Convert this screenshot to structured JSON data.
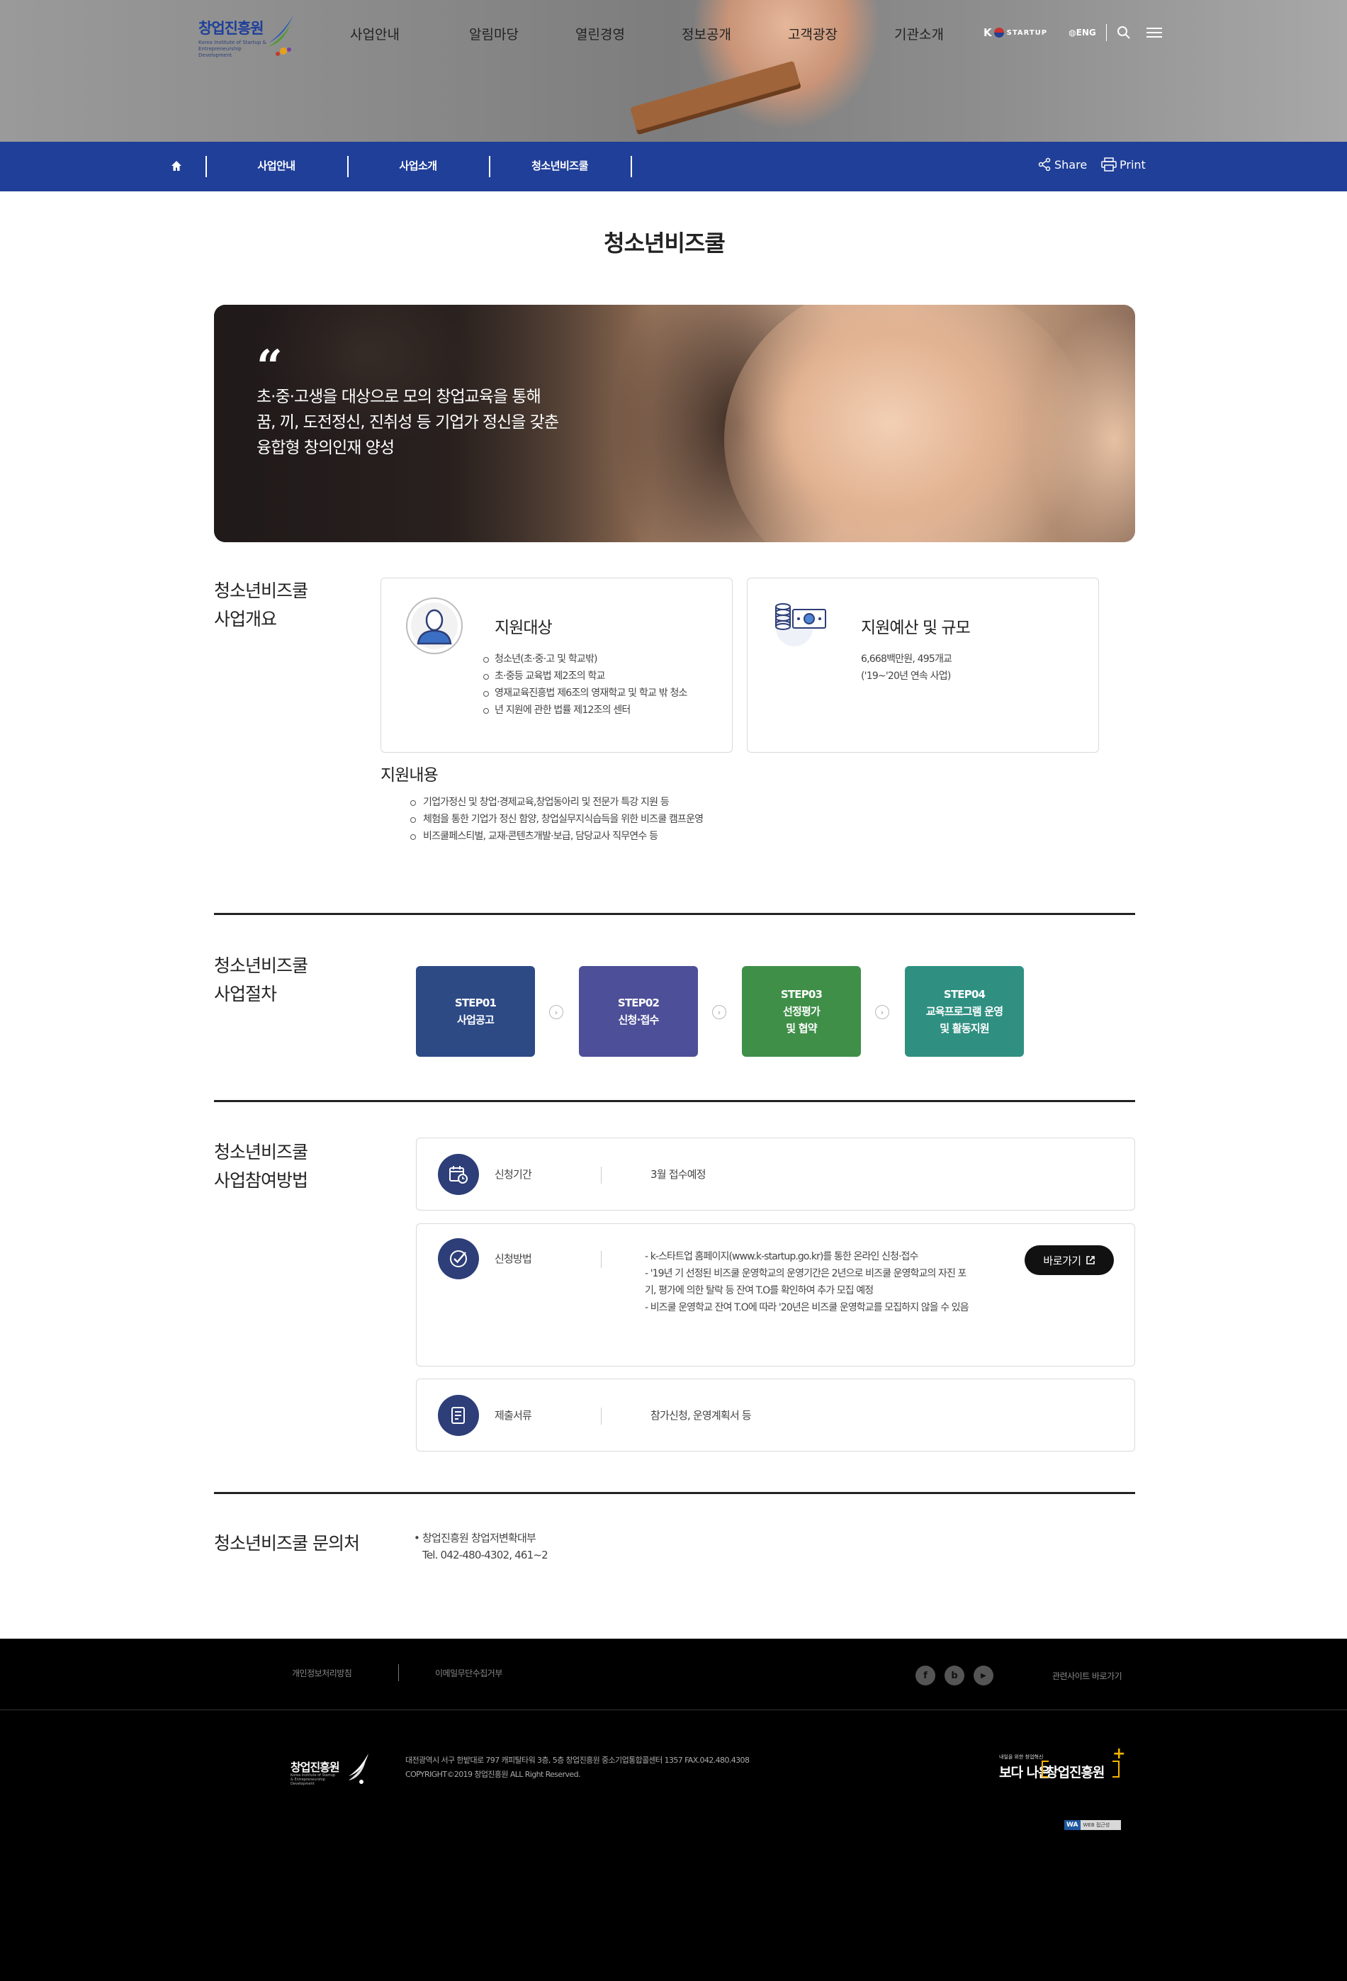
{
  "header": {
    "logo_text": "창업진흥원",
    "logo_sub": "Korea Institute of Startup & Entrepreneurship Development",
    "gnb": [
      "사업안내",
      "알림마당",
      "열린경영",
      "정보공개",
      "고객광장",
      "기관소개"
    ],
    "kstartup_k": "K",
    "kstartup_label": "STARTUP",
    "eng_label": "ENG"
  },
  "location": {
    "items": [
      "사업안내",
      "사업소개",
      "청소년비즈쿨"
    ],
    "share_label": "Share",
    "print_label": "Print"
  },
  "page_title": "청소년비즈쿨",
  "hero": {
    "quote_mark": "“",
    "lines": [
      "초·중·고생을 대상으로 모의 창업교육을 통해",
      "꿈, 끼, 도전정신, 진취성 등 기업가 정신을 갖춘",
      "융합형 창의인재 양성"
    ]
  },
  "overview": {
    "title_lines": [
      "청소년비즈쿨",
      "사업개요"
    ],
    "target": {
      "title": "지원대상",
      "items": [
        "청소년(초·중·고 및 학교밖)",
        "초·중등 교육법 제2조의 학교",
        "영재교육진흥법 제6조의 영재학교 및 학교 밖 청소",
        "년 지원에 관한 법률 제12조의 센터"
      ]
    },
    "budget": {
      "title": "지원예산 및 규모",
      "lines": [
        "6,668백만원, 495개교",
        "('19~'20년 연속 사업)"
      ]
    },
    "support": {
      "title": "지원내용",
      "items": [
        "기업가정신 및 창업·경제교육,창업동아리 및 전문가 특강 지원 등",
        "체험을 통한 기업가 정신 함양, 창업실무지식습득을 위한 비즈쿨 캠프운영",
        "비즈쿨페스티벌, 교재·콘텐츠개발·보급, 담당교사 직무연수 등"
      ]
    }
  },
  "procedure": {
    "title_lines": [
      "청소년비즈쿨",
      "사업절차"
    ],
    "steps": [
      {
        "no": "STEP01",
        "line1": "사업공고",
        "line2": "",
        "color": "#2d4a85"
      },
      {
        "no": "STEP02",
        "line1": "신청·접수",
        "line2": "",
        "color": "#4d4f98"
      },
      {
        "no": "STEP03",
        "line1": "선정평가",
        "line2": "및 협약",
        "color": "#3f8f48"
      },
      {
        "no": "STEP04",
        "line1": "교육프로그램 운영",
        "line2": "및 활동지원",
        "color": "#2f9082"
      }
    ],
    "arrow": "›"
  },
  "participation": {
    "title_lines": [
      "청소년비즈쿨",
      "사업참여방법"
    ],
    "period": {
      "label": "신청기간",
      "value": "3월 접수예정"
    },
    "method": {
      "label": "신청방법",
      "lines": [
        "- k-스타트업 홈페이지(www.k-startup.go.kr)를 통한 온라인 신청·접수",
        "- '19년 기 선정된 비즈쿨 운영학교의 운영기간은 2년으로 비즈쿨 운영학교의 자진 포",
        "기, 평가에 의한 탈락 등 잔여 T.O를 확인하여 추가 모집 예정",
        "- 비즈쿨 운영학교 잔여 T.O에 따라 '20년은 비즈쿨 운영학교를 모집하지 않을 수 있음"
      ],
      "button_label": "바로가기"
    },
    "documents": {
      "label": "제출서류",
      "value": "참가신청, 운영계획서 등"
    }
  },
  "contact": {
    "title": "청소년비즈쿨 문의처",
    "lines": [
      "• 창업진흥원 창업저변확대부",
      "Tel. 042-480-4302, 461~2"
    ]
  },
  "footer": {
    "links": [
      "개인정보처리방침",
      "이메일무단수집거부"
    ],
    "sns": [
      "f",
      "b",
      "▶"
    ],
    "related": "관련사이트 바로가기",
    "logo_text": "창업진흥원",
    "logo_sub": "Korea Institute of Startup & Entrepreneurship Development",
    "address": "대전광역시 서구 한밭대로 797 캐피탈타워 3층, 5층 창업진흥원 중소기업통합콜센터 1357 FAX.042.480.4308",
    "copyright": "COPYRIGHT©2019 창업진흥원 ALL Right Reserved.",
    "brand_small": "내일을 위한 창업혁신",
    "brand_big1": "보다 나은",
    "brand_big2": "창업진흥원",
    "brand_plus": "+",
    "wa_badge": "WA",
    "wa_text": "WEB 접근성"
  },
  "colors": {
    "location_bar": "#203f98",
    "icon_circle": "#2d3e78",
    "brand_accent": "#f4b400"
  }
}
